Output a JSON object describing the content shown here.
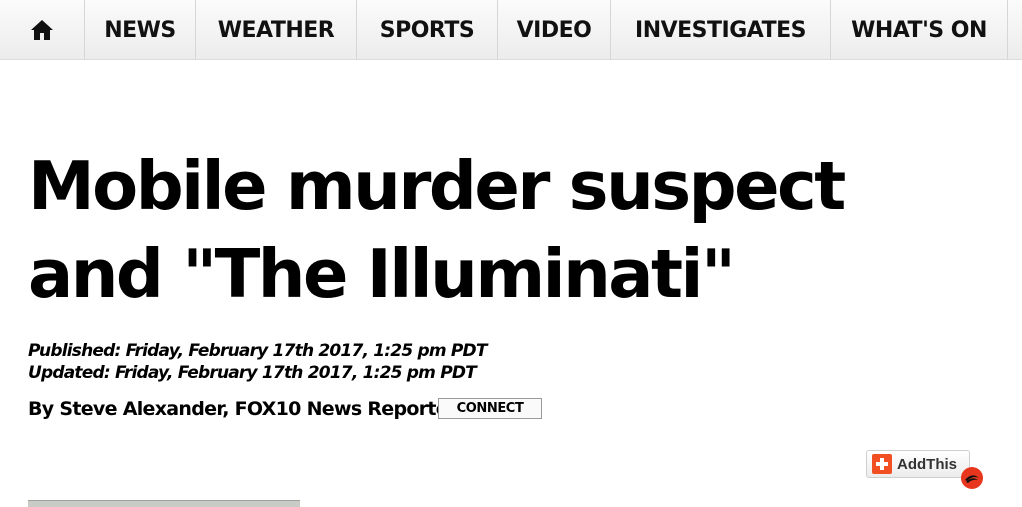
{
  "nav": {
    "home_icon": "home-icon",
    "items": [
      {
        "label": "NEWS"
      },
      {
        "label": "WEATHER"
      },
      {
        "label": "SPORTS"
      },
      {
        "label": "VIDEO"
      },
      {
        "label": "INVESTIGATES"
      },
      {
        "label": "WHAT'S ON"
      }
    ]
  },
  "article": {
    "headline": "Mobile murder suspect and \"The Illuminati\"",
    "published": "Published: Friday, February 17th 2017, 1:25 pm PDT",
    "updated": "Updated: Friday, February 17th 2017, 1:25 pm PDT",
    "byline": "By Steve Alexander, FOX10 News Reporter",
    "connect_label": "CONNECT"
  },
  "share": {
    "addthis_label": "AddThis",
    "addthis_icon": "plus-icon",
    "adchoice_icon": "adchoice-icon",
    "accent_color": "#f25022"
  }
}
